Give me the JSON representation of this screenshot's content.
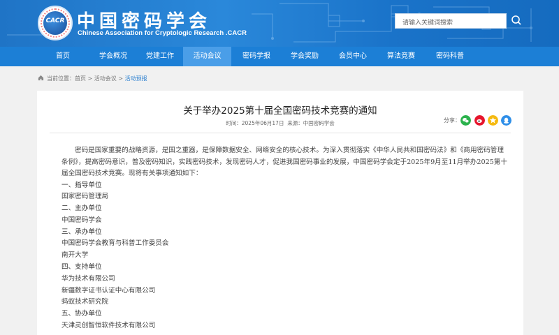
{
  "header": {
    "title_cn": "中国密码学会",
    "title_en": "Chinese Association for Cryptologic Research .CACR",
    "logo_text": "CACR",
    "search_placeholder": "请输入关键词搜索"
  },
  "nav": {
    "items": [
      "首页",
      "学会概况",
      "党建工作",
      "活动会议",
      "密码学报",
      "学会奖励",
      "会员中心",
      "算法竞赛",
      "密码科普"
    ],
    "active_index": 3
  },
  "breadcrumb": {
    "prefix": "当前位置：",
    "home": "首页",
    "sep1": " > ",
    "level1": "活动会议",
    "sep2": " > ",
    "level2": "活动预报"
  },
  "article": {
    "title": "关于举办2025第十届全国密码技术竞赛的通知",
    "time_label": "时间：",
    "time": "2025年06月17日",
    "source_label": "来源：",
    "source": "中国密码学会",
    "share_label": "分享：",
    "intro": "密码是国家重要的战略资源，是国之重器，是保障数据安全、网络安全的核心技术。为深入贯彻落实《中华人民共和国密码法》和《商用密码管理条例》，提高密码意识，普及密码知识，实践密码技术，发现密码人才，促进我国密码事业的发展，中国密码学会定于2025年9月至11月举办2025第十届全国密码技术竞赛。现将有关事项通知如下：",
    "sections": [
      {
        "heading": "一、指导单位",
        "lines": [
          "国家密码管理局"
        ]
      },
      {
        "heading": "二、主办单位",
        "lines": [
          "中国密码学会"
        ]
      },
      {
        "heading": "三、承办单位",
        "lines": [
          "中国密码学会教育与科普工作委员会",
          "南开大学"
        ]
      },
      {
        "heading": "四、支持单位",
        "lines": [
          "华为技术有限公司",
          "新疆数字证书认证中心有限公司",
          "蚂蚁技术研究院"
        ]
      },
      {
        "heading": "五、协办单位",
        "lines": [
          "天津灵创智恒软件技术有限公司"
        ]
      }
    ]
  },
  "colors": {
    "header_blue": "#1f74c6",
    "nav_blue": "#1c7fd6",
    "nav_active": "#4a9ee8",
    "wechat": "#2bb24c",
    "weibo": "#e6162d",
    "qzone": "#f5b90f",
    "qq": "#2f8fe8"
  },
  "icons": {
    "search": "search-icon",
    "home": "home-icon",
    "share": [
      "wechat-icon",
      "weibo-icon",
      "qzone-icon",
      "qq-icon"
    ]
  }
}
